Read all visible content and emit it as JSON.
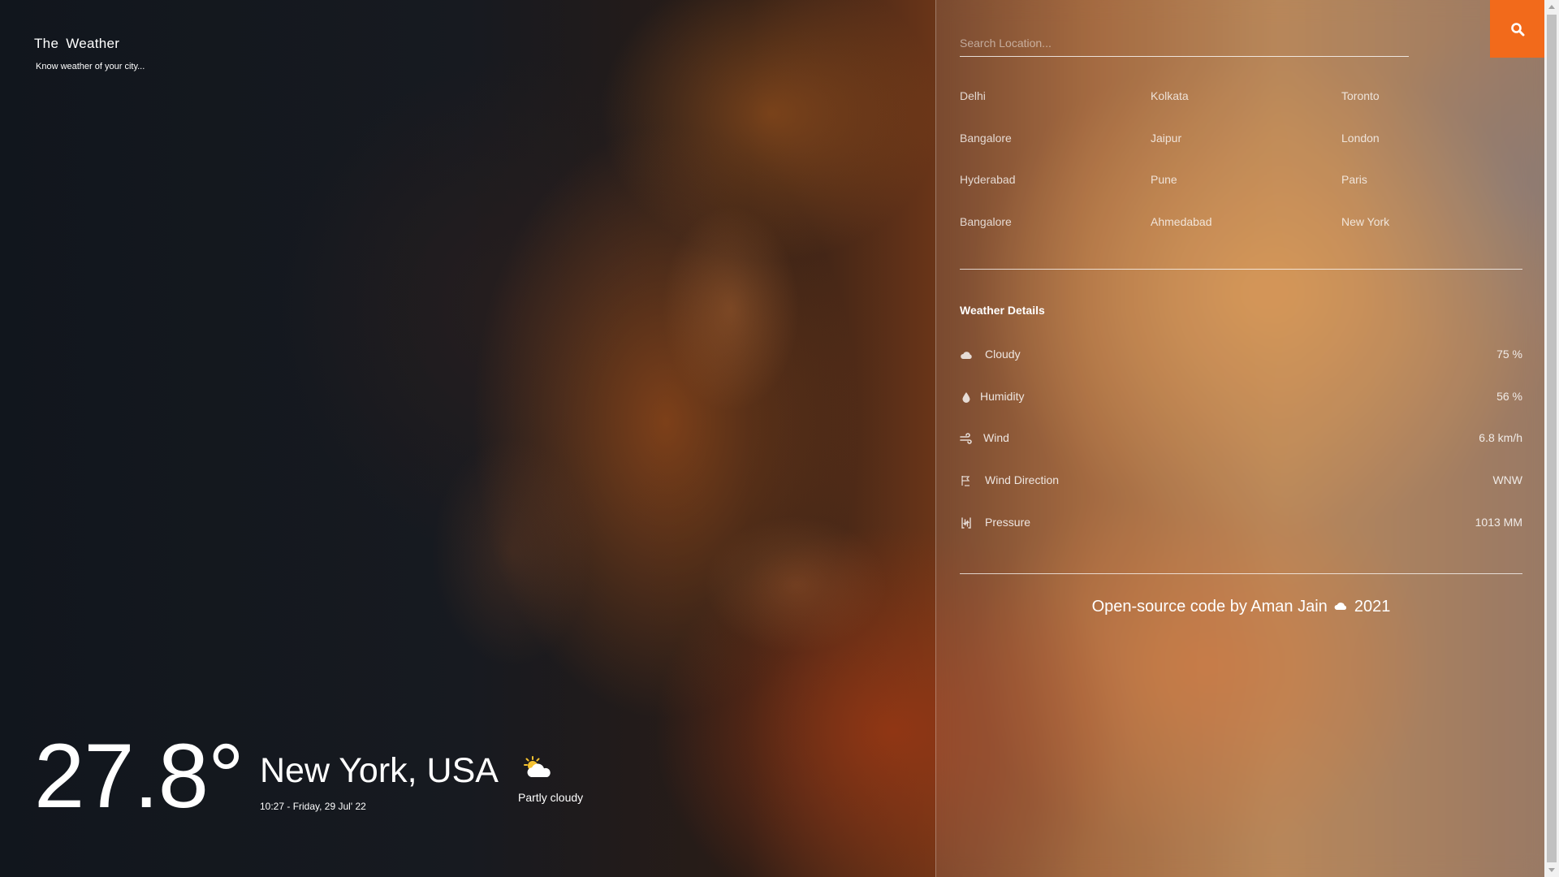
{
  "brand": {
    "title": "The  Weather",
    "tagline": "Know weather of your city..."
  },
  "current": {
    "temperature": "27.8°",
    "city": "New York, USA",
    "datetime": "10:27 - Friday, 29 Jul' 22",
    "condition": "Partly cloudy",
    "condition_icon": "partly-cloudy-icon"
  },
  "search": {
    "placeholder": "Search Location...",
    "button_icon": "search-icon",
    "button_color": "#f26a1b"
  },
  "cities": [
    "Delhi",
    "Kolkata",
    "Toronto",
    "Bangalore",
    "Jaipur",
    "London",
    "Hyderabad",
    "Pune",
    "Paris",
    "Bangalore",
    "Ahmedabad",
    "New York"
  ],
  "details": {
    "title": "Weather Details",
    "rows": [
      {
        "label": "Cloudy",
        "value": "75 %",
        "icon": "cloud-icon"
      },
      {
        "label": "Humidity",
        "value": "56 %",
        "icon": "droplet-icon"
      },
      {
        "label": "Wind",
        "value": "6.8 km/h",
        "icon": "wind-icon"
      },
      {
        "label": "Wind Direction",
        "value": "WNW",
        "icon": "compass-icon"
      },
      {
        "label": "Pressure",
        "value": "1013 MM",
        "icon": "pressure-icon"
      }
    ]
  },
  "footer": {
    "prefix": "Open-source code by Aman Jain",
    "year": "2021"
  }
}
